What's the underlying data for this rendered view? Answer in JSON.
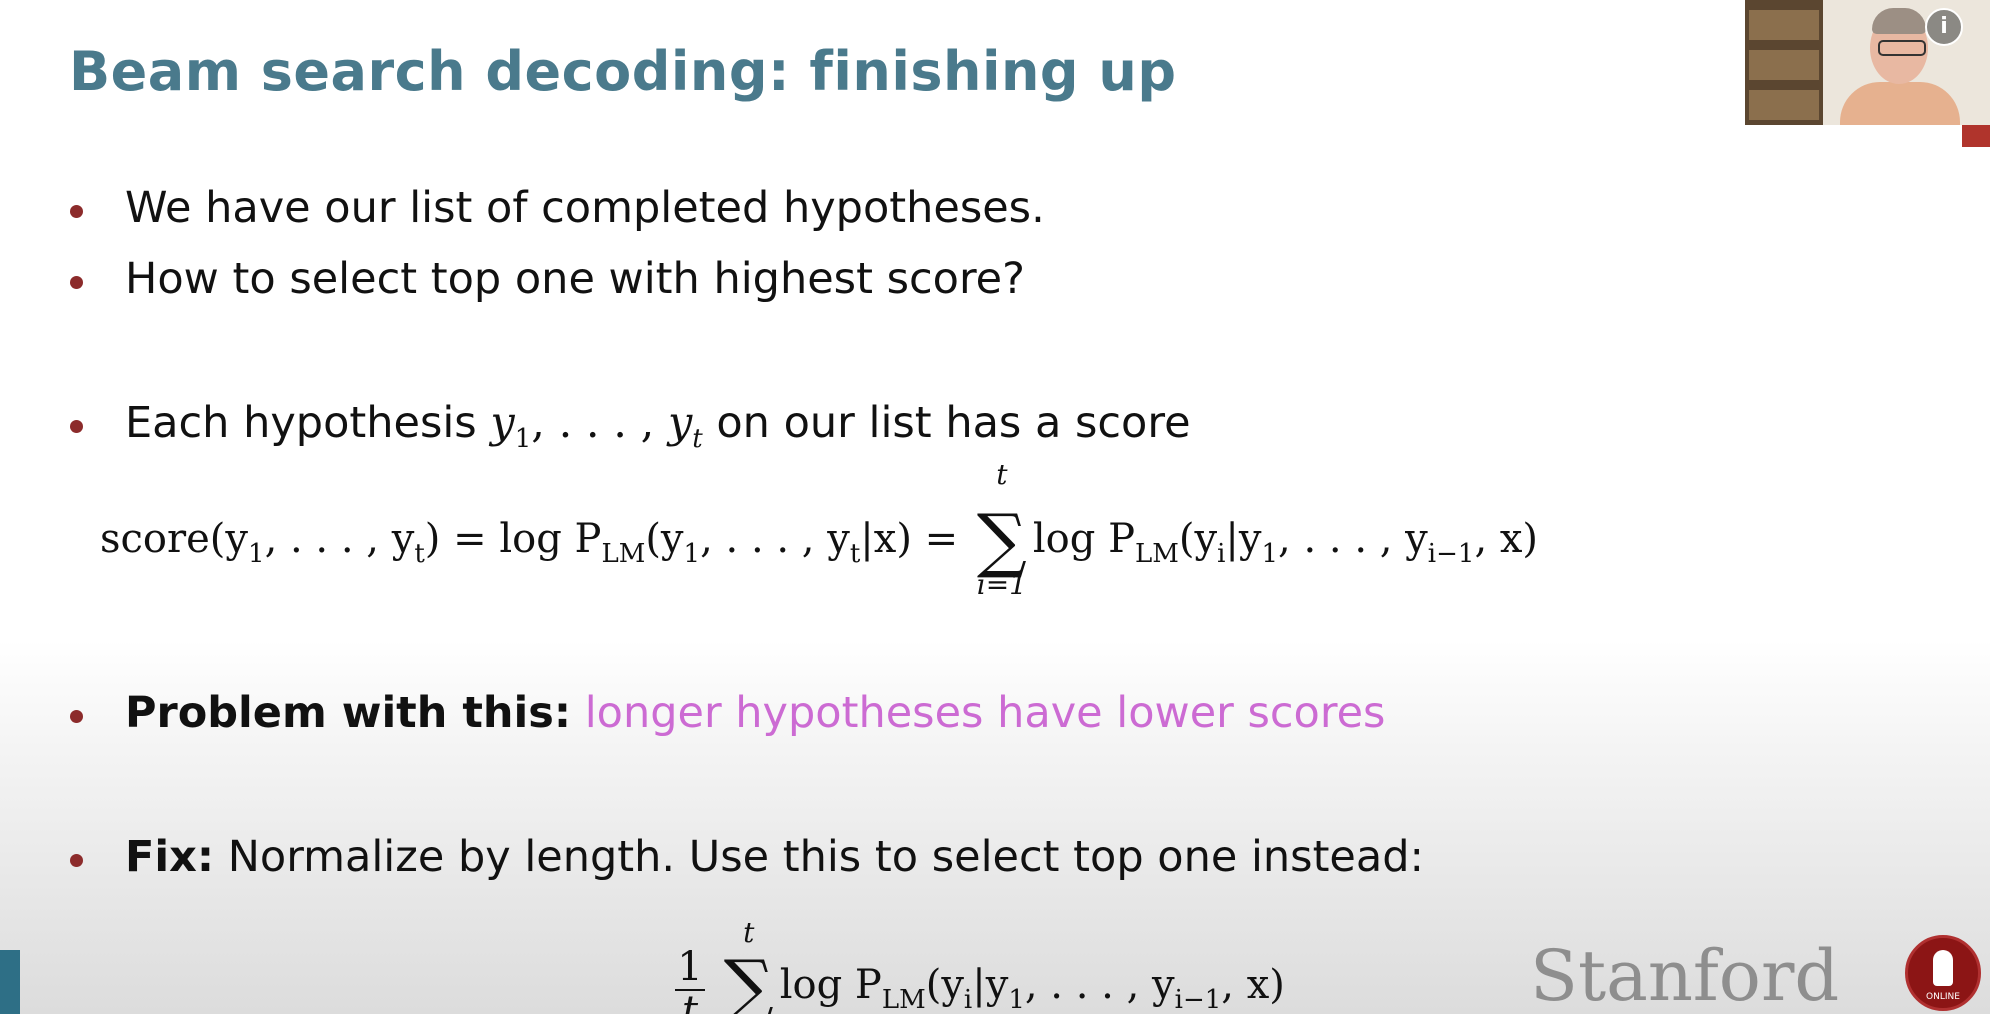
{
  "slide": {
    "title": "Beam search decoding: finishing up",
    "bullets": {
      "b1": "We have our list of completed hypotheses.",
      "b2": "How to select top one with highest score?",
      "b3_pre": "Each hypothesis",
      "b3_math_y1": "y",
      "b3_math_dots": ", . . . ,",
      "b3_post": "on our list has a score",
      "b4_bold": "Problem with this:",
      "b4_pink": "longer hypotheses have lower scores",
      "b5_bold": "Fix:",
      "b5_rest": "Normalize by length. Use this to select top one instead:"
    },
    "equation1": {
      "lhs": "score(y",
      "lhs_mid": ", . . . , y",
      "lhs_end": ") = log P",
      "lm": "LM",
      "mid": "(y",
      "mid2": ", . . . , y",
      "mid3": "|x) =",
      "sum_top": "t",
      "sum_bottom": "i=1",
      "rhs": "log P",
      "rhs2": "(y",
      "rhs3": "|y",
      "rhs4": ", . . . , y",
      "rhs5": ", x)"
    },
    "equation2": {
      "frac_num": "1",
      "frac_den": "t",
      "sum_top": "t",
      "rhs": "log P",
      "lm": "LM",
      "rhs2": "(y",
      "rhs3": "|y",
      "rhs4": ", . . . , y",
      "rhs5": ", x)"
    },
    "sub_1": "1",
    "sub_t": "t",
    "sub_i": "i",
    "sub_im1": "i−1",
    "logo_text": "Stanford",
    "seal_label": "ONLINE"
  },
  "video_overlay": {
    "info_icon": "i"
  },
  "colors": {
    "title": "#4a7a8c",
    "bullet_dot": "#8c2b2b",
    "highlight": "#cc6bd3",
    "logo_text": "#8e8e8e"
  }
}
